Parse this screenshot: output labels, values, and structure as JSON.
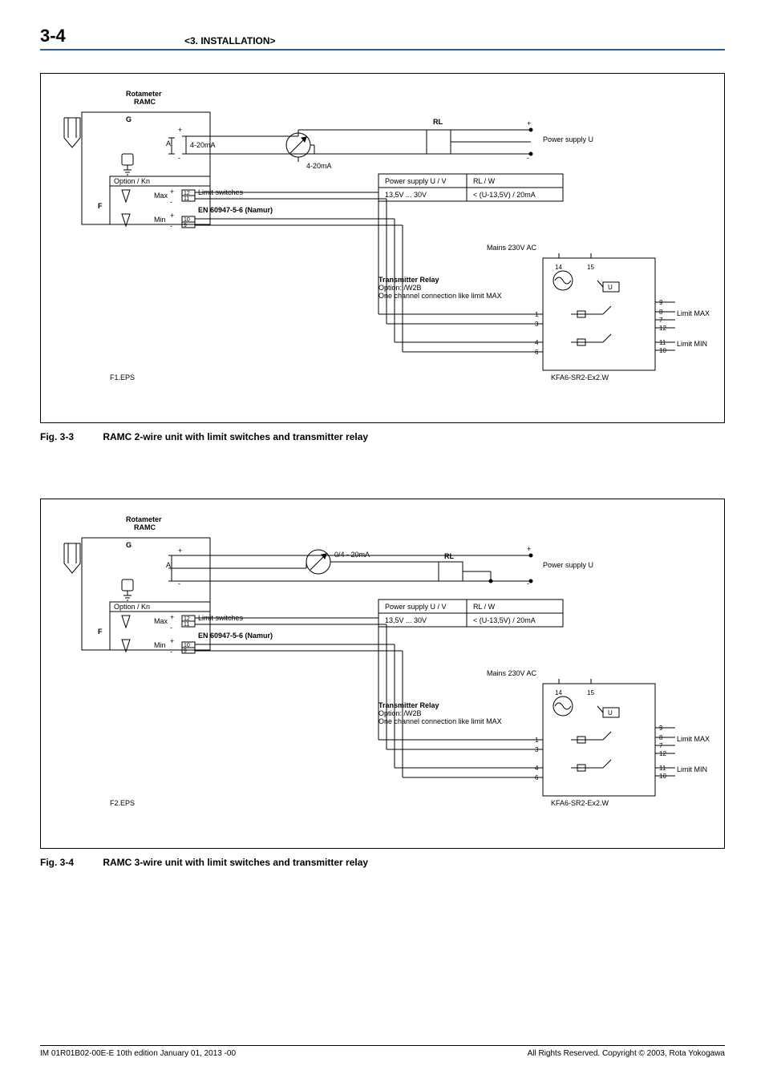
{
  "header": {
    "page_number": "3-4",
    "section": "<3. INSTALLATION>"
  },
  "figures": {
    "f1": {
      "caption_no": "Fig. 3-3",
      "caption_text": "RAMC  2-wire unit with limit switches and transmitter relay",
      "title_top": "Rotameter",
      "title_sub": "RAMC",
      "labelG": "G",
      "labelF": "F",
      "labelA": "A",
      "sig_plus": "+",
      "sig_minus": "-",
      "signal_420": "4-20mA",
      "signal_420_2": "4-20mA",
      "RL": "RL",
      "power_u": "Power supply U",
      "ps_plus": "+",
      "ps_minus": "-",
      "table_h1": "Power supply U / V",
      "table_h2": "RL / W",
      "table_c1": "13,5V ... 30V",
      "table_c2": "< (U-13,5V) / 20mA",
      "option_kn": "Option / Kn",
      "limit_switches": "Limit switches",
      "max": "Max",
      "min": "Min",
      "t12": "12",
      "t11": "11",
      "t10": "10",
      "t9": "9",
      "namur": "EN 60947-5-6 (Namur)",
      "eps": "F1.EPS",
      "mains": "Mains 230V AC",
      "m14": "14",
      "m15": "15",
      "relay_l1": "Transmitter Relay",
      "relay_l2": "Option: /W2B",
      "relay_l3": "One channel connection like limit MAX",
      "U": "U",
      "r1": "1",
      "r3": "3",
      "r4": "4",
      "r6": "6",
      "r9": "9",
      "r8": "8",
      "r7": "7",
      "r12": "12",
      "r11": "11",
      "r10": "10",
      "lmax": "Limit MAX",
      "lmin": "Limit MIN",
      "model": "KFA6-SR2-Ex2.W"
    },
    "f2": {
      "caption_no": "Fig. 3-4",
      "caption_text": "RAMC  3-wire unit with limit switches and transmitter relay",
      "title_top": "Rotameter",
      "title_sub": "RAMC",
      "labelG": "G",
      "labelF": "F",
      "labelA": "A",
      "sig_plus": "+",
      "sig_minus": "-",
      "signal_0420": "0/4 - 20mA",
      "RL": "RL",
      "power_u": "Power supply U",
      "ps_plus": "+",
      "ps_minus": "-",
      "table_h1": "Power supply U / V",
      "table_h2": "RL / W",
      "table_c1": "13,5V ... 30V",
      "table_c2": "< (U-13,5V) / 20mA",
      "option_kn": "Option / Kn",
      "limit_switches": "Limit switches",
      "max": "Max",
      "min": "Min",
      "t12": "12",
      "t11": "11",
      "t10": "10",
      "t9": "9",
      "namur": "EN 60947-5-6 (Namur)",
      "eps": "F2.EPS",
      "mains": "Mains 230V AC",
      "m14": "14",
      "m15": "15",
      "relay_l1": "Transmitter Relay",
      "relay_l2": "Option: /W2B",
      "relay_l3": "One channel connection like limit MAX",
      "U": "U",
      "r1": "1",
      "r3": "3",
      "r4": "4",
      "r6": "6",
      "r9": "9",
      "r8": "8",
      "r7": "7",
      "r12": "12",
      "r11": "11",
      "r10": "10",
      "lmax": "Limit MAX",
      "lmin": "Limit MIN",
      "model": "KFA6-SR2-Ex2.W"
    }
  },
  "footer": {
    "left": "IM 01R01B02-00E-E   10th edition January 01, 2013 -00",
    "right": "All Rights Reserved. Copyright © 2003, Rota Yokogawa"
  }
}
